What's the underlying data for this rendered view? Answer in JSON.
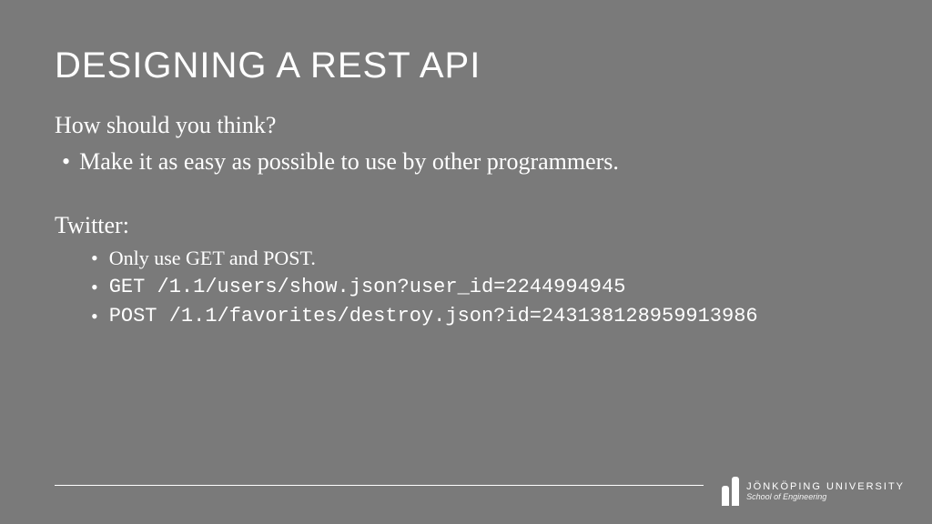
{
  "title": "DESIGNING A REST API",
  "subtitle": "How should you think?",
  "mainBullet": "Make it as easy as possible to use by other programmers.",
  "sectionLabel": "Twitter:",
  "subBullets": [
    {
      "text": "Only use GET and POST.",
      "code": false
    },
    {
      "text": "GET  /1.1/users/show.json?user_id=2244994945",
      "code": true
    },
    {
      "text": "POST /1.1/favorites/destroy.json?id=243138128959913986",
      "code": true
    }
  ],
  "logo": {
    "main": "JÖNKÖPING UNIVERSITY",
    "sub": "School of Engineering"
  }
}
